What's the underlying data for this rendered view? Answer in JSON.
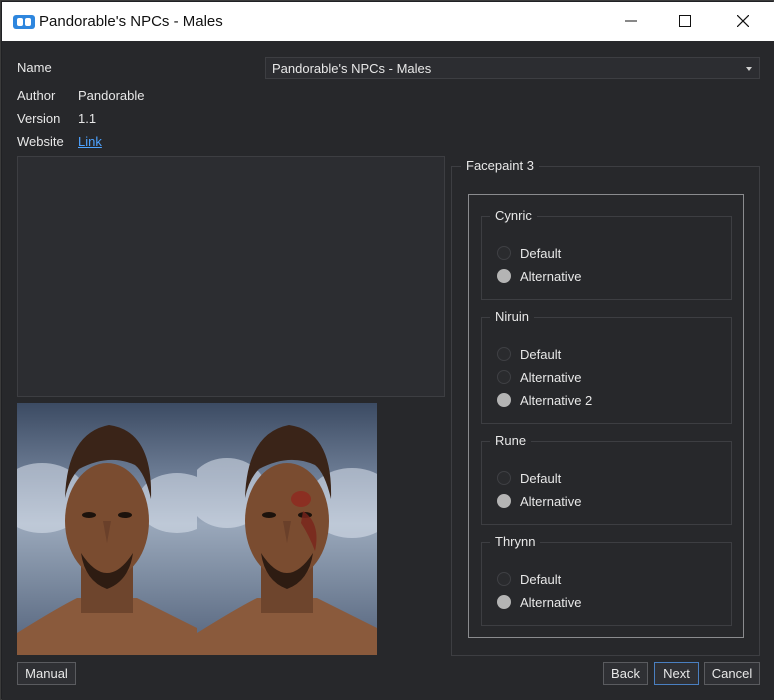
{
  "window": {
    "title": "Pandorable's NPCs - Males"
  },
  "info": {
    "name_label": "Name",
    "name_value": "Pandorable's NPCs - Males",
    "author_label": "Author",
    "author_value": "Pandorable",
    "version_label": "Version",
    "version_value": "1.1",
    "website_label": "Website",
    "website_link": "Link"
  },
  "options": {
    "title": "Facepaint 3",
    "groups": [
      {
        "name": "Cynric",
        "choices": [
          "Default",
          "Alternative"
        ],
        "selected": "Alternative"
      },
      {
        "name": "Niruin",
        "choices": [
          "Default",
          "Alternative",
          "Alternative 2"
        ],
        "selected": "Alternative 2"
      },
      {
        "name": "Rune",
        "choices": [
          "Default",
          "Alternative"
        ],
        "selected": "Alternative"
      },
      {
        "name": "Thrynn",
        "choices": [
          "Default",
          "Alternative"
        ],
        "selected": "Alternative"
      }
    ]
  },
  "buttons": {
    "manual": "Manual",
    "back": "Back",
    "next": "Next",
    "cancel": "Cancel"
  },
  "colors": {
    "background": "#27282b",
    "link": "#4ea3ff",
    "focus": "#4a7fc0"
  }
}
